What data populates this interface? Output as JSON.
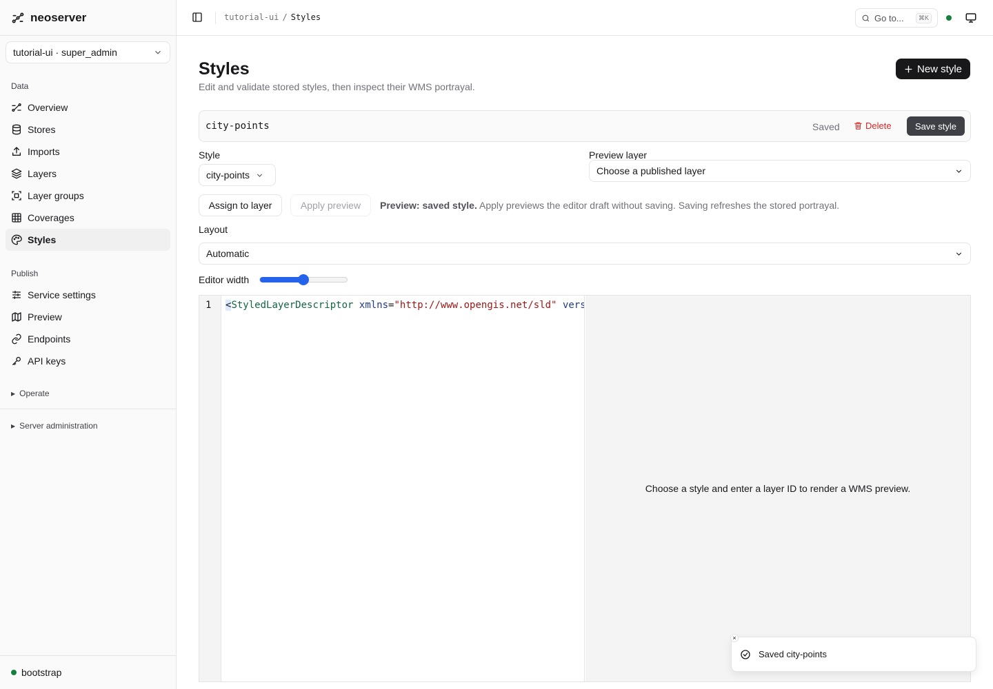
{
  "app": {
    "name": "neoserver"
  },
  "workspace_switcher": {
    "value": "tutorial-ui · super_admin"
  },
  "sidebar": {
    "data_section": "Data",
    "data_items": [
      {
        "label": "Overview",
        "icon": "overview-icon"
      },
      {
        "label": "Stores",
        "icon": "database-icon"
      },
      {
        "label": "Imports",
        "icon": "upload-icon"
      },
      {
        "label": "Layers",
        "icon": "layers-icon"
      },
      {
        "label": "Layer groups",
        "icon": "layer-groups-icon"
      },
      {
        "label": "Coverages",
        "icon": "grid-icon"
      },
      {
        "label": "Styles",
        "icon": "palette-icon",
        "active": true
      }
    ],
    "publish_section": "Publish",
    "publish_items": [
      {
        "label": "Service settings",
        "icon": "sliders-icon"
      },
      {
        "label": "Preview",
        "icon": "map-icon"
      },
      {
        "label": "Endpoints",
        "icon": "link-icon"
      },
      {
        "label": "API keys",
        "icon": "key-icon"
      }
    ],
    "operate_label": "Operate",
    "server_admin_label": "Server administration",
    "footer_status": "bootstrap",
    "footer_status_color": "#15803d"
  },
  "topbar": {
    "breadcrumb_parent": "tutorial-ui",
    "breadcrumb_sep": "/",
    "breadcrumb_current": "Styles",
    "goto_label": "Go to...",
    "goto_shortcut": "⌘K"
  },
  "page": {
    "title": "Styles",
    "subtitle": "Edit and validate stored styles, then inspect their WMS portrayal.",
    "new_style_label": "New style"
  },
  "style_bar": {
    "name": "city-points",
    "status": "Saved",
    "delete_label": "Delete",
    "save_label": "Save style"
  },
  "form": {
    "style_label": "Style",
    "style_value": "city-points",
    "preview_layer_label": "Preview layer",
    "preview_layer_value": "Choose a published layer",
    "assign_label": "Assign to layer",
    "apply_label": "Apply preview",
    "preview_note_bold": "Preview: saved style.",
    "preview_note_rest": " Apply previews the editor draft without saving. Saving refreshes the stored portrayal.",
    "layout_label": "Layout",
    "layout_value": "Automatic",
    "editor_width_label": "Editor width",
    "editor_width_fraction": 0.5
  },
  "editor": {
    "line_number": "1",
    "code_open": "<",
    "code_tag": "StyledLayerDescriptor",
    "code_attr": "xmlns",
    "code_eq": "=",
    "code_str": "\"http://www.opengis.net/sld\"",
    "code_attr2": "vers"
  },
  "preview": {
    "message": "Choose a style and enter a layer ID to render a WMS preview."
  },
  "toast": {
    "message": "Saved city-points",
    "close": "×"
  },
  "colors": {
    "accent": "#2563eb",
    "primary_button": "#18181b",
    "danger": "#dc2626",
    "status_ok": "#15803d"
  }
}
